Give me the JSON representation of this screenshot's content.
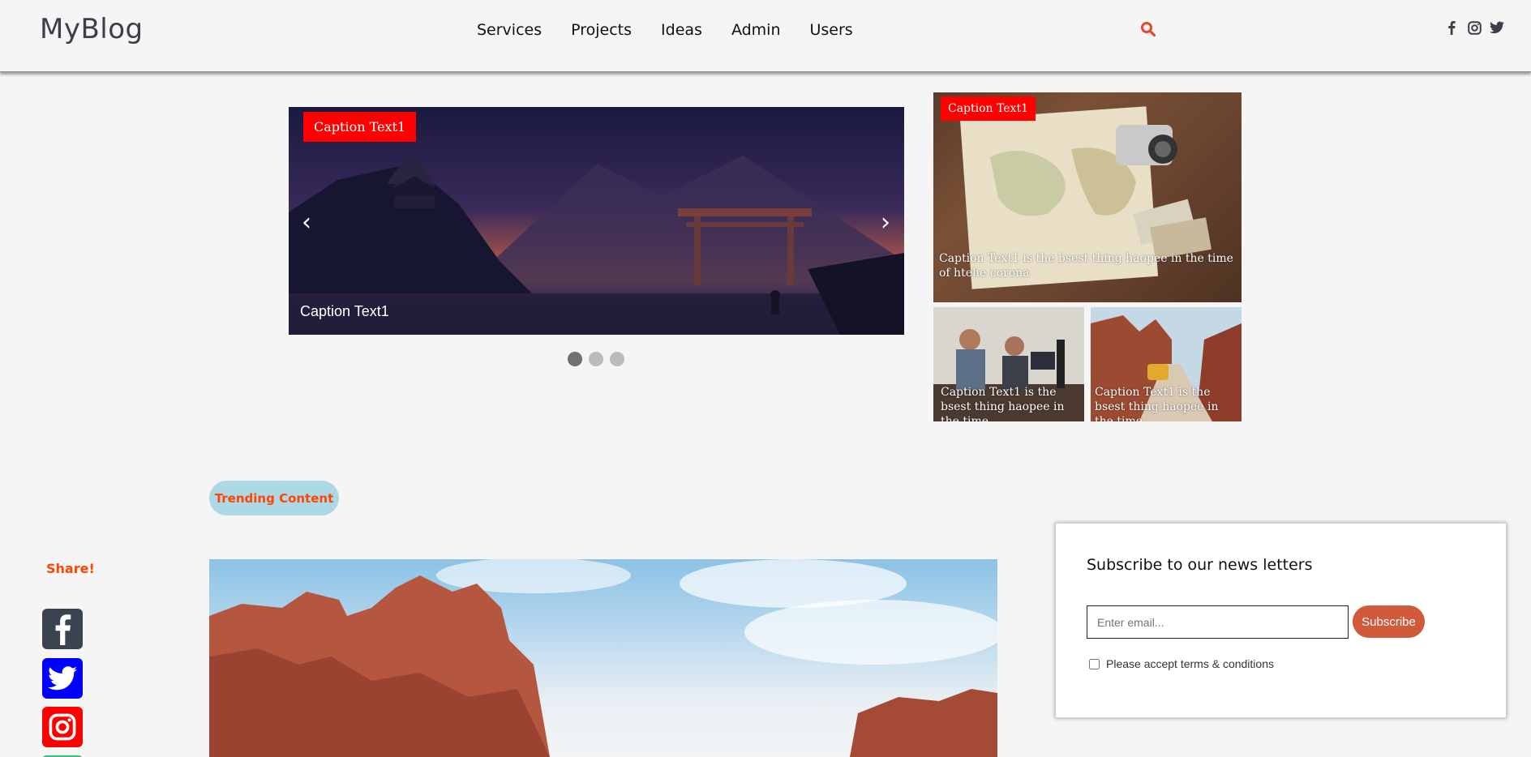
{
  "header": {
    "logo": "MyBlog",
    "nav": [
      "Services",
      "Projects",
      "Ideas",
      "Admin",
      "Users"
    ],
    "search_icon": "search-icon",
    "social_icons": [
      "facebook-icon",
      "instagram-icon",
      "twitter-icon"
    ]
  },
  "carousel": {
    "badge": "Caption Text1",
    "caption": "Caption Text1",
    "prev": "‹",
    "next": "›",
    "slides": 3,
    "active_slide": 1
  },
  "tiles": {
    "main": {
      "badge": "Caption Text1",
      "caption": "Caption Text1 is the bsest thing haopee in the time of htehe corona"
    },
    "left": {
      "caption": "Caption Text1 is the bsest thing haopee in the time"
    },
    "right": {
      "caption": "Caption Text1 is the bsest thing haopee in the time"
    }
  },
  "trending": {
    "label": "Trending Content"
  },
  "share": {
    "label": "Share!"
  },
  "newsletter": {
    "title": "Subscribe to our news letters",
    "email_placeholder": "Enter email...",
    "subscribe_label": "Subscribe",
    "terms_label": "Please accept terms & conditions"
  },
  "colors": {
    "accent": "#ff4500",
    "badge_red": "#ff0000",
    "subscribe_btn": "#d05a3b",
    "trending_bg": "#add8e6"
  }
}
